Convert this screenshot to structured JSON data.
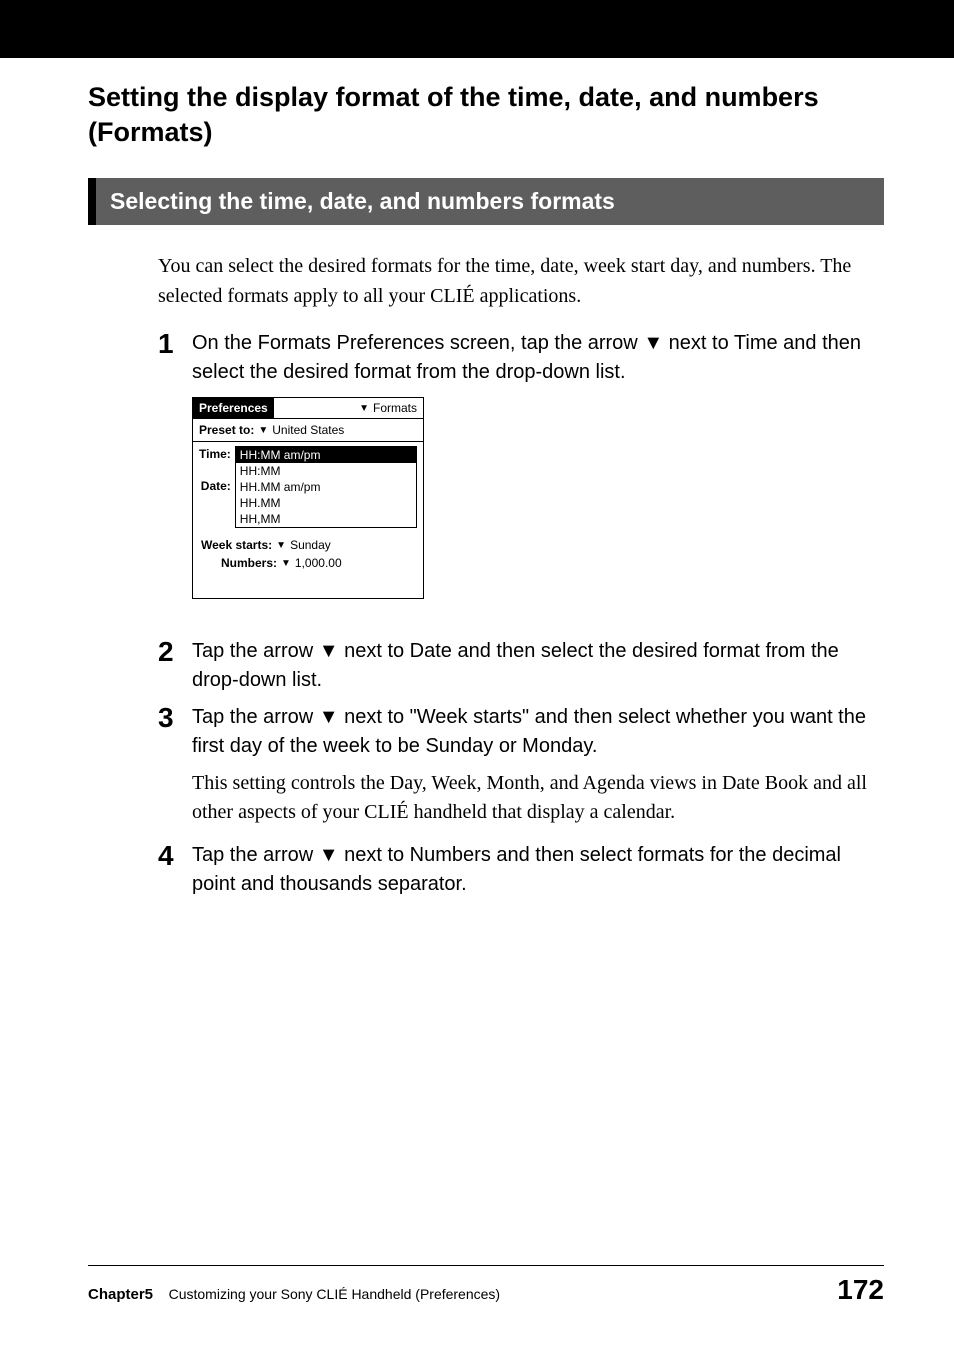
{
  "main_title": "Setting the display format of the time, date, and numbers (Formats)",
  "section_title": "Selecting the time, date, and numbers formats",
  "intro": "You can select the desired formats for the time, date, week start day, and numbers. The selected formats apply to all your CLIÉ applications.",
  "steps": {
    "s1": {
      "num": "1",
      "text_a": "On the Formats Preferences screen, tap the arrow ",
      "arrow": "▼",
      "text_b": " next to Time and then select the desired format from the drop-down list."
    },
    "s2": {
      "num": "2",
      "text_a": "Tap the arrow ",
      "arrow": "▼",
      "text_b": " next to Date and then select the desired format from the drop-down list."
    },
    "s3": {
      "num": "3",
      "text_a": "Tap the arrow ",
      "arrow": "▼",
      "text_b": " next to \"Week starts\" and then select whether you want the first day of the week to be Sunday or Monday.",
      "note": "This setting controls the Day, Week, Month, and Agenda views in Date Book and all other aspects of your CLIÉ handheld that display a calendar."
    },
    "s4": {
      "num": "4",
      "text_a": "Tap the arrow ",
      "arrow": "▼",
      "text_b": " next to Numbers and then select formats for the decimal point and thousands separator."
    }
  },
  "screenshot": {
    "title_left": "Preferences",
    "title_right": "Formats",
    "preset_label": "Preset to:",
    "preset_value": "United States",
    "time_label": "Time:",
    "date_label": "Date:",
    "dd": [
      "HH:MM am/pm",
      "HH:MM",
      "HH.MM am/pm",
      "HH.MM",
      "HH,MM"
    ],
    "week_label": "Week starts:",
    "week_value": "Sunday",
    "numbers_label": "Numbers:",
    "numbers_value": "1,000.00",
    "tri": "▼"
  },
  "footer": {
    "chapter": "Chapter5",
    "desc": "Customizing your Sony CLIÉ Handheld (Preferences)",
    "page": "172"
  }
}
